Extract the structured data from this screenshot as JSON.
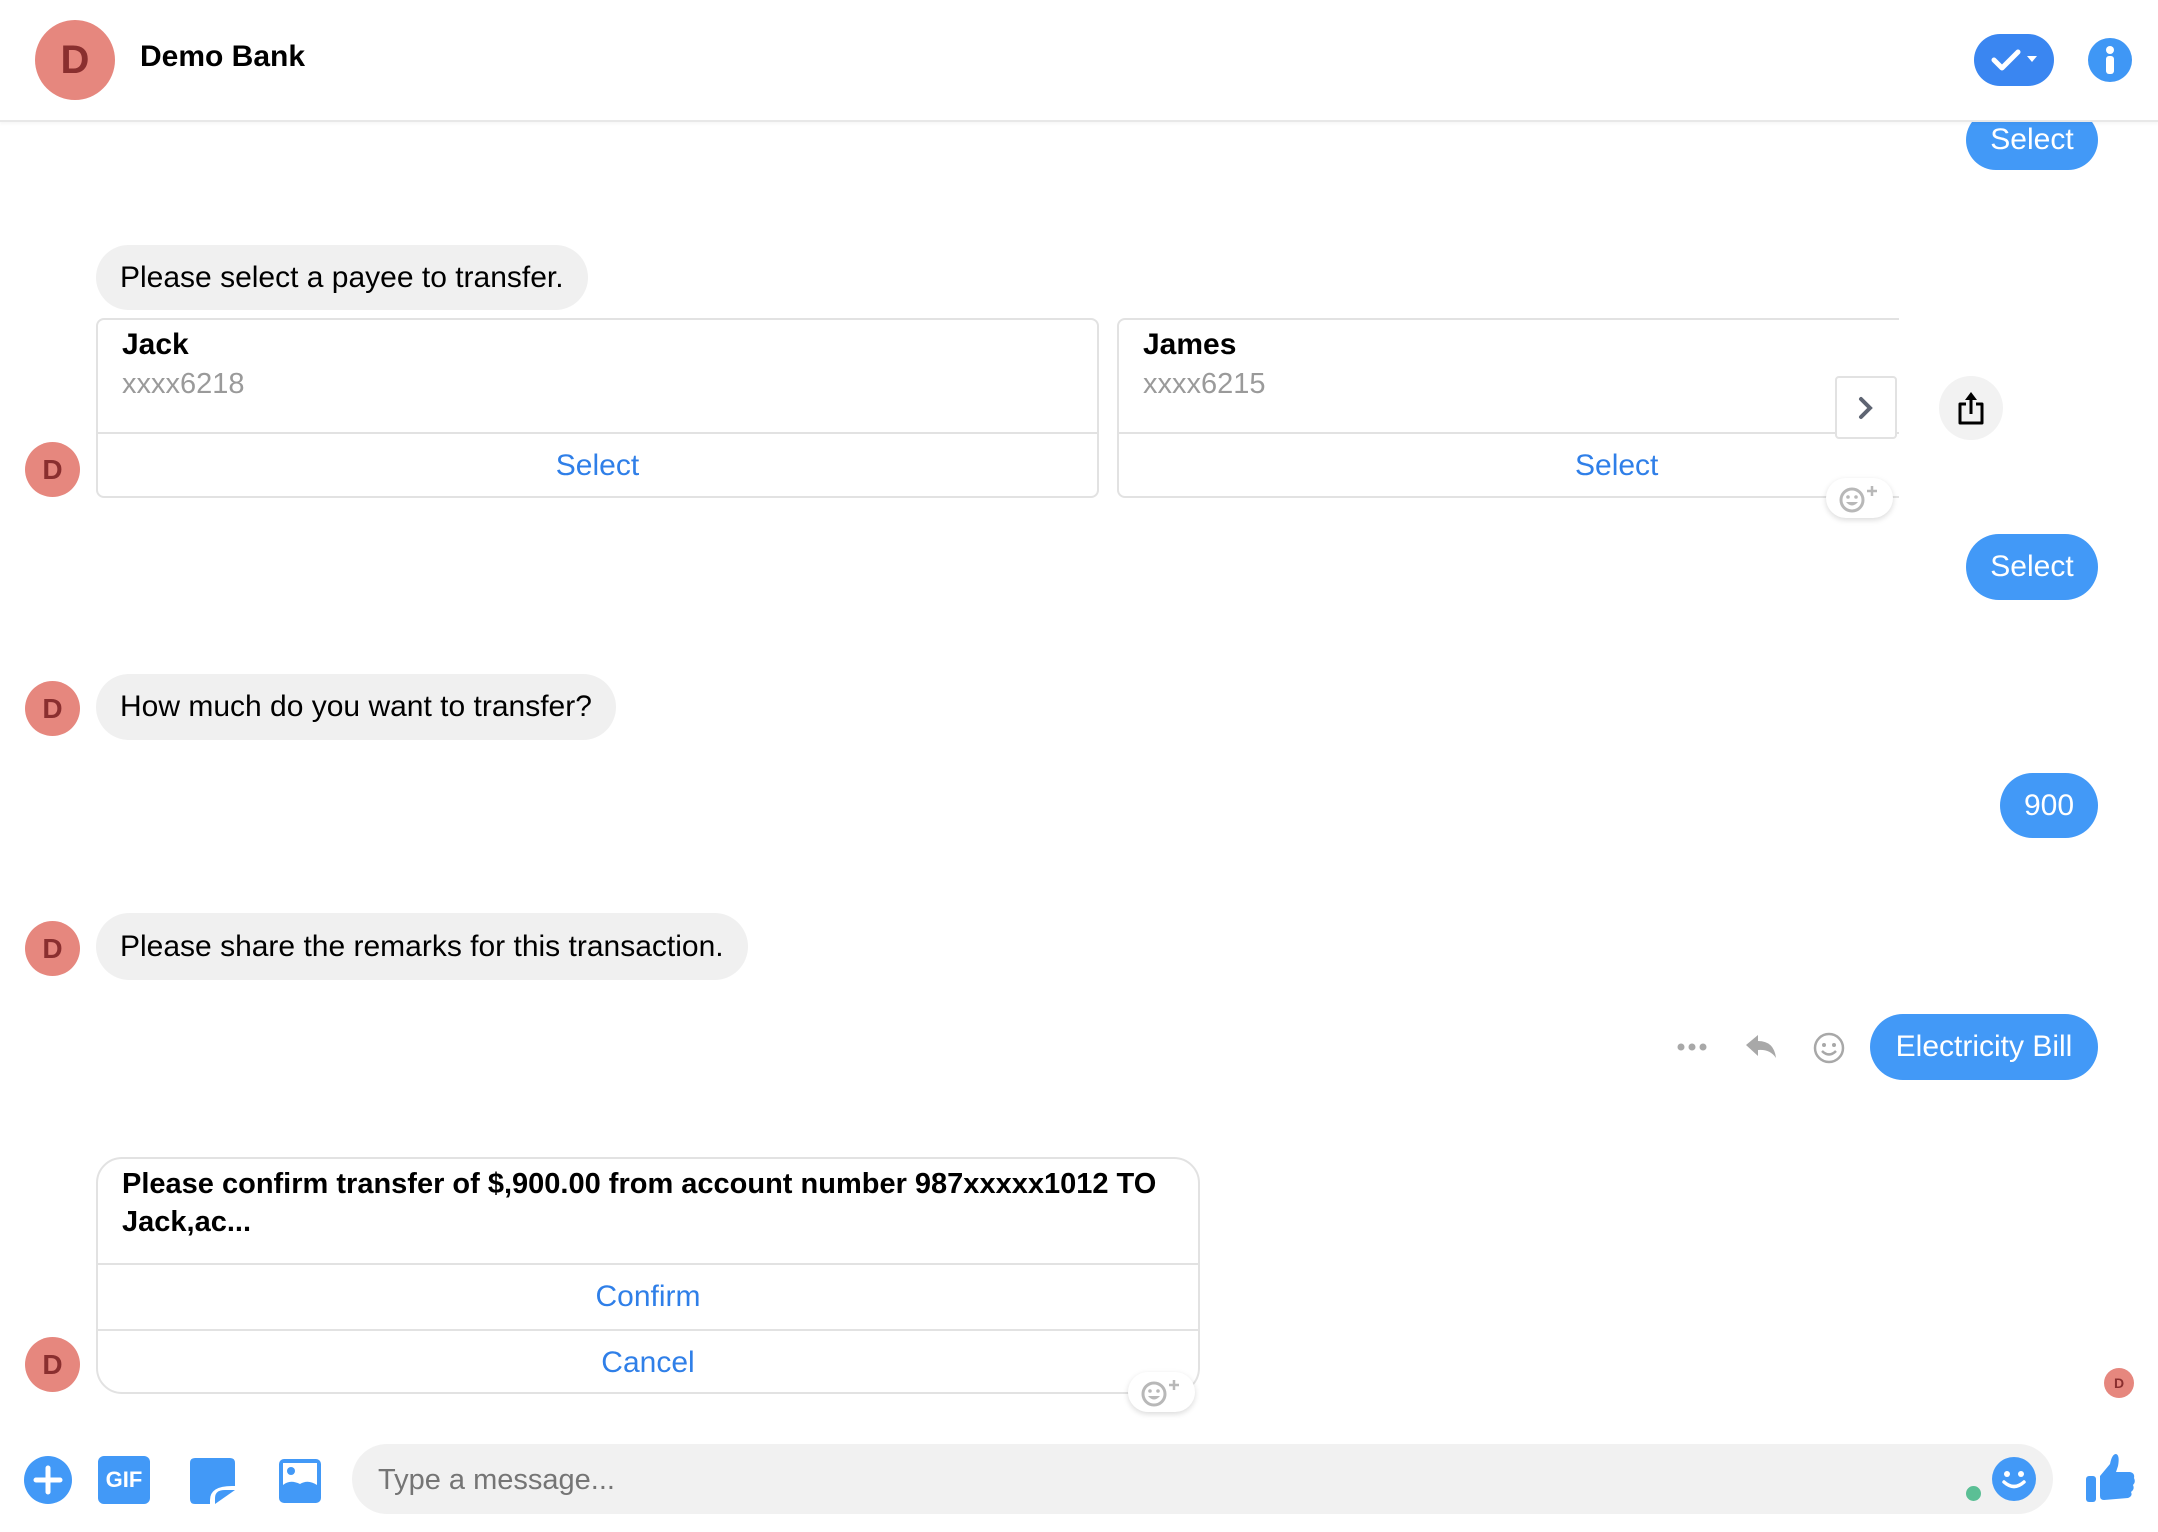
{
  "header": {
    "avatar_letter": "D",
    "title": "Demo Bank",
    "check_button_icon": "checkmark-dropdown-icon",
    "info_button_icon": "info-icon"
  },
  "colors": {
    "accent": "#4299f7",
    "header_accent": "#3a86f1",
    "link_blue": "#2f7fe8",
    "avatar_bg": "#e6877e",
    "avatar_text": "#8a2f2f",
    "bot_bubble_bg": "#f0f0f0",
    "online_dot": "#5bbf95"
  },
  "messages": [
    {
      "from": "user",
      "text": "Select"
    },
    {
      "from": "bot",
      "text": "Please select a payee to transfer."
    },
    {
      "from": "bot",
      "type": "carousel",
      "cards": [
        {
          "title": "Jack",
          "subtitle": "xxxx6218",
          "button": "Select"
        },
        {
          "title": "James",
          "subtitle": "xxxx6215",
          "button": "Select"
        }
      ]
    },
    {
      "from": "user",
      "text": "Select"
    },
    {
      "from": "bot",
      "text": "How much do you want to transfer?"
    },
    {
      "from": "user",
      "text": "900"
    },
    {
      "from": "bot",
      "text": "Please share the remarks for this transaction."
    },
    {
      "from": "user",
      "text": "Electricity Bill"
    },
    {
      "from": "bot",
      "type": "confirm",
      "text": "Please confirm transfer of $,900.00 from account number 987xxxxx1012 TO Jack,ac...",
      "buttons": [
        "Confirm",
        "Cancel"
      ]
    }
  ],
  "avatar_letter": "D",
  "composer": {
    "placeholder": "Type a message...",
    "gif_label": "GIF"
  }
}
